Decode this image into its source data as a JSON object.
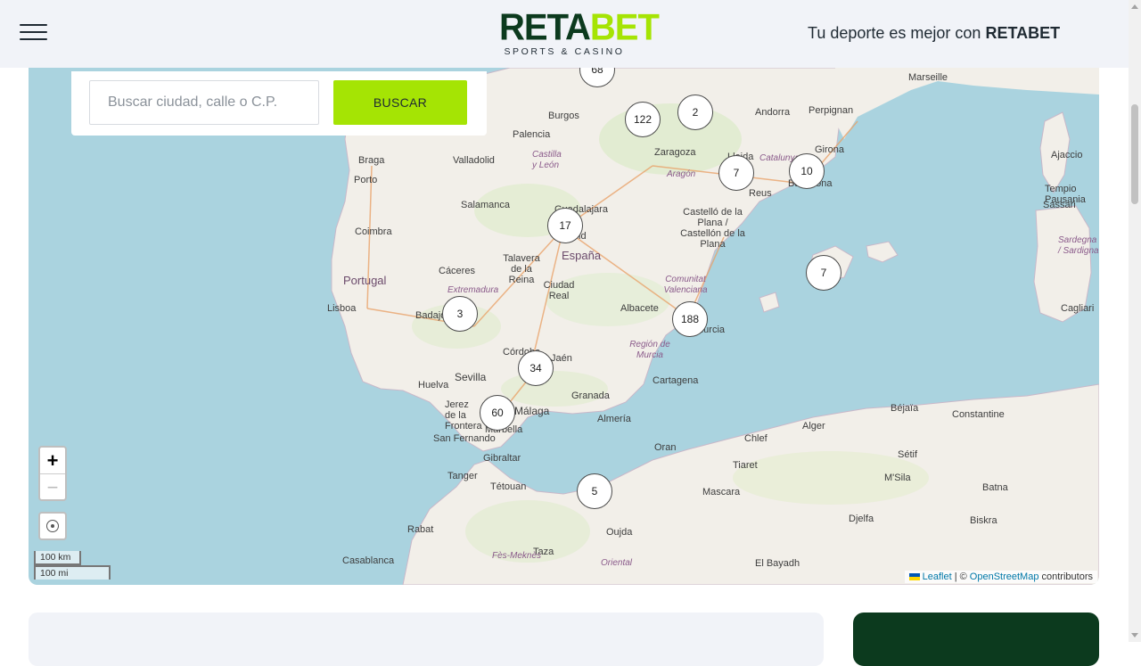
{
  "header": {
    "logo_reta": "RETA",
    "logo_bet": "BET",
    "logo_sub": "SPORTS & CASINO",
    "tagline_prefix": "Tu deporte es mejor con",
    "tagline_brand": "RETABET"
  },
  "search": {
    "placeholder": "Buscar ciudad, calle o C.P.",
    "button_label": "BUSCAR"
  },
  "clusters": [
    "68",
    "122",
    "2",
    "7",
    "10",
    "17",
    "7",
    "3",
    "188",
    "34",
    "60",
    "5"
  ],
  "places": [
    "Marseille",
    "Burgos",
    "Andorra",
    "Perpignan",
    "Palencia",
    "Zaragoza",
    "Girona",
    "Ajaccio",
    "Braga",
    "Valladolid",
    "Castilla y León",
    "Lleida",
    "Catalunya",
    "Porto",
    "Aragón",
    "Reus",
    "Barcelona",
    "Tempio Pausania",
    "Salamanca",
    "Guadalajara",
    "Castelló de la Plana / Castellón de la Plana",
    "Sassari",
    "Coimbra",
    "Madrid",
    "Sardegna / Sardigna",
    "Portugal",
    "Talavera de la Reina",
    "España",
    "Cáceres",
    "Extremadura",
    "Ciudad Real",
    "Comunitat Valenciana",
    "Lisboa",
    "Badajoz",
    "Albacete",
    "Cagliari",
    "Córdoba",
    "Región de Murcia",
    "Murcia",
    "Huelva",
    "Sevilla",
    "Jaén",
    "Granada",
    "Cartagena",
    "Jerez de la Frontera",
    "Málaga",
    "Almería",
    "Marbella",
    "Béjaïa",
    "Constantine",
    "Alger",
    "San Fernando",
    "Gibraltar",
    "Oran",
    "Chlef",
    "Tiaret",
    "Sétif",
    "Tanger",
    "Tétouan",
    "Mascara",
    "M'Sila",
    "Batna",
    "Rabat",
    "Taza",
    "Oujda",
    "Djelfa",
    "Biskra",
    "Casablanca",
    "Fès-Meknès",
    "Oriental",
    "El Bayadh"
  ],
  "map_controls": {
    "zoom_in": "+",
    "zoom_out": "−",
    "scale_km": "100 km",
    "scale_mi": "100 mi"
  },
  "attribution": {
    "leaflet": "Leaflet",
    "separator": "| ©",
    "osm": "OpenStreetMap",
    "contributors": "contributors"
  },
  "colors": {
    "brand_dark": "#0c3a1e",
    "brand_accent": "#a5e404",
    "sea": "#aad3df",
    "land": "#f2efe9"
  },
  "icons": {
    "menu": "hamburger-menu-icon",
    "locate": "locate-me-icon",
    "flag": "ukraine-flag-icon"
  }
}
